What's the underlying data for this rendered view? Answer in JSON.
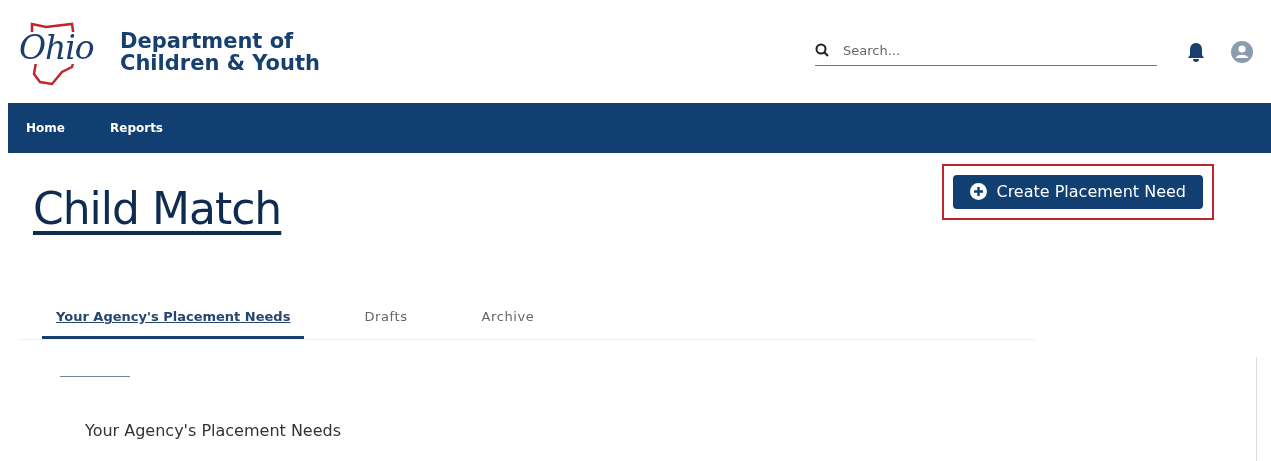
{
  "header": {
    "logo_text": "Ohio",
    "agency_name": [
      "Department of",
      "Children & Youth"
    ],
    "search": {
      "placeholder": "Search..."
    }
  },
  "nav": [
    {
      "label": "Home"
    },
    {
      "label": "Reports"
    }
  ],
  "page_title": "Child Match",
  "create_button": {
    "label": "Create Placement Need",
    "highlighted": true
  },
  "tabs": [
    {
      "label": "Your Agency's Placement Needs",
      "selected": true
    },
    {
      "label": "Drafts",
      "selected": false
    },
    {
      "label": "Archive",
      "selected": false
    }
  ],
  "section_heading": "Your Agency's Placement Needs"
}
